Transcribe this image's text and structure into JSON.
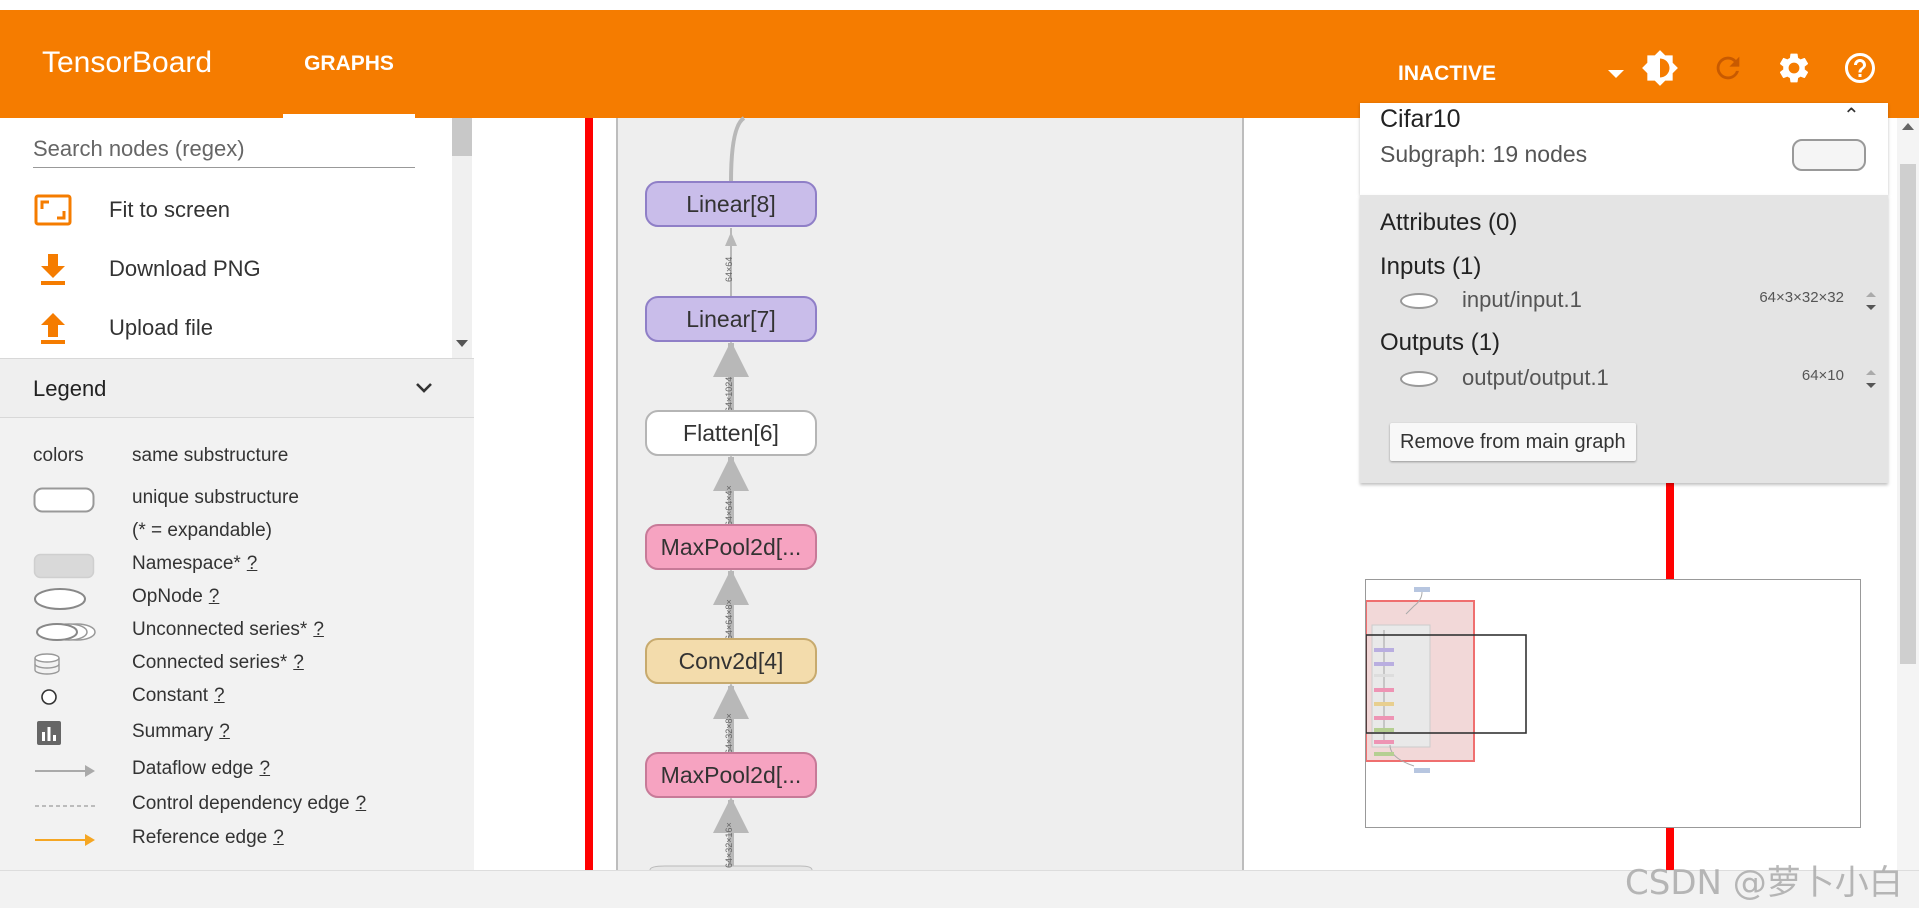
{
  "header": {
    "brand": "TensorBoard",
    "tab_graphs": "GRAPHS",
    "run_status": "INACTIVE",
    "icons": [
      "brightness-icon",
      "refresh-icon",
      "settings-icon",
      "help-icon"
    ]
  },
  "sidebar": {
    "search_placeholder": "Search nodes (regex)",
    "actions": [
      {
        "label": "Fit to screen",
        "icon": "fit-screen-icon"
      },
      {
        "label": "Download PNG",
        "icon": "download-icon"
      },
      {
        "label": "Upload file",
        "icon": "upload-icon"
      }
    ],
    "legend_title": "Legend",
    "legend": {
      "colors_label": "colors",
      "colors_desc": "same substructure",
      "unique_desc": "unique substructure",
      "expandable_note": "(* = expandable)",
      "namespace": "Namespace*",
      "opnode": "OpNode",
      "unconnected": "Unconnected series*",
      "connected": "Connected series*",
      "constant": "Constant",
      "summary": "Summary",
      "dataflow": "Dataflow edge",
      "control": "Control dependency edge",
      "reference": "Reference edge",
      "help_mark": "?"
    }
  },
  "graph": {
    "nodes": [
      {
        "label": "Linear[8]",
        "fill": "#c9bdea",
        "stroke": "#8f7fc7"
      },
      {
        "label": "Linear[7]",
        "fill": "#c9bdea",
        "stroke": "#8f7fc7"
      },
      {
        "label": "Flatten[6]",
        "fill": "#ffffff",
        "stroke": "#b5b5b5"
      },
      {
        "label": "MaxPool2d[...",
        "fill": "#f6a3c1",
        "stroke": "#c77a98"
      },
      {
        "label": "Conv2d[4]",
        "fill": "#f3dcac",
        "stroke": "#c7aa6e"
      },
      {
        "label": "MaxPool2d[...",
        "fill": "#f6a3c1",
        "stroke": "#c77a98"
      }
    ],
    "edge_labels": [
      "64×64",
      "64×1024",
      "64×64×4×",
      "64×64×8×",
      "64×32×8×",
      "64×32×16×"
    ]
  },
  "info": {
    "name": "Cifar10",
    "subgraph": "Subgraph: 19 nodes",
    "attributes": "Attributes (0)",
    "inputs_title": "Inputs (1)",
    "input_name": "input/input.1",
    "input_shape": "64×3×32×32",
    "outputs_title": "Outputs (1)",
    "output_name": "output/output.1",
    "output_shape": "64×10",
    "remove_button": "Remove from main graph",
    "close_symbol": "⌃"
  },
  "watermark": "CSDN @萝卜小白",
  "colors": {
    "header": "#f57c00",
    "selection": "#ff0000"
  }
}
